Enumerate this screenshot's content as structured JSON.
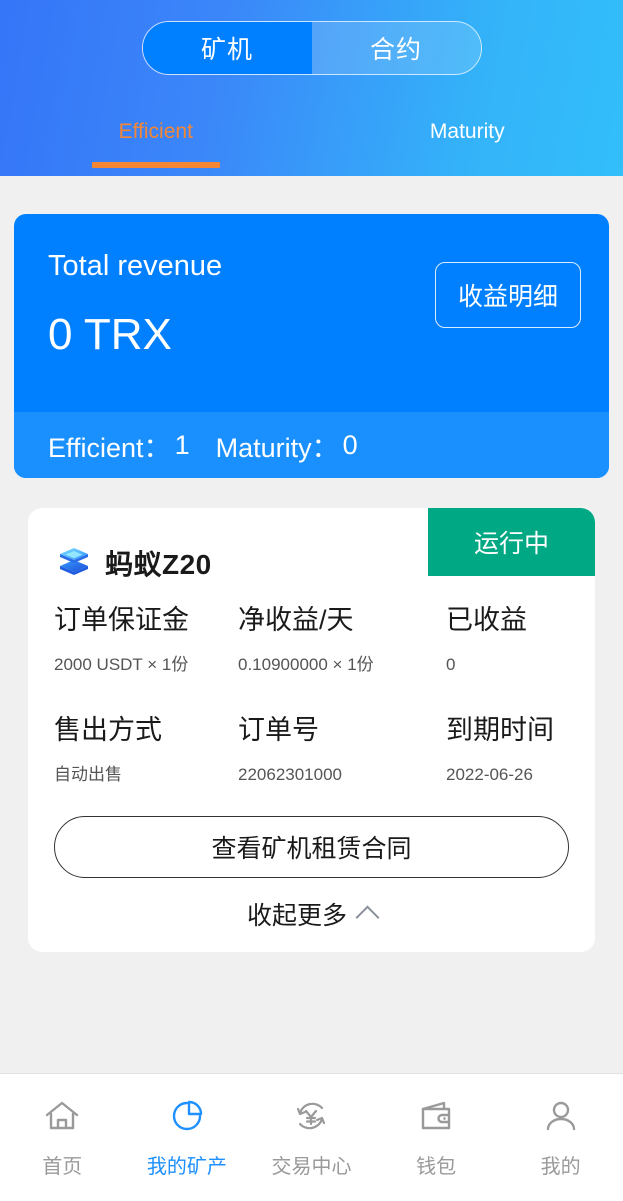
{
  "header": {
    "segments": [
      {
        "label": "矿机",
        "active": true
      },
      {
        "label": "合约",
        "active": false
      }
    ],
    "subtabs": [
      {
        "label": "Efficient",
        "active": true
      },
      {
        "label": "Maturity",
        "active": false
      }
    ],
    "colors": {
      "gradient_start": "#3575f8",
      "gradient_end": "#32bffa",
      "active_segment": "#0080ff",
      "active_subtab": "#f58634"
    }
  },
  "revenue": {
    "label": "Total revenue",
    "amount": "0 TRX",
    "detail_button": "收益明细",
    "efficient_label": "Efficient：",
    "efficient_count": "1",
    "maturity_label": "Maturity：",
    "maturity_count": "0",
    "colors": {
      "card": "#0080ff",
      "footer": "#1a90ff"
    }
  },
  "miner": {
    "name": "蚂蚁Z20",
    "status": "运行中",
    "status_color": "#00a884",
    "icon": "stacked-cubes-icon",
    "fields": [
      {
        "head": "订单保证金",
        "value": "2000 USDT × 1份"
      },
      {
        "head": "净收益/天",
        "value": "0.10900000 × 1份"
      },
      {
        "head": "已收益",
        "value": "0"
      },
      {
        "head": "售出方式",
        "value": "自动出售"
      },
      {
        "head": "订单号",
        "value": "22062301000"
      },
      {
        "head": "到期时间",
        "value": "2022-06-26"
      }
    ],
    "contract_button": "查看矿机租赁合同",
    "collapse_label": "收起更多"
  },
  "bottom_nav": {
    "active_color": "#1e90ff",
    "inactive_color": "#9a9a9a",
    "items": [
      {
        "label": "首页",
        "icon": "home-icon",
        "active": false
      },
      {
        "label": "我的矿产",
        "icon": "pie-chart-icon",
        "active": true
      },
      {
        "label": "交易中心",
        "icon": "exchange-yuan-icon",
        "active": false
      },
      {
        "label": "钱包",
        "icon": "wallet-icon",
        "active": false
      },
      {
        "label": "我的",
        "icon": "person-icon",
        "active": false
      }
    ]
  }
}
